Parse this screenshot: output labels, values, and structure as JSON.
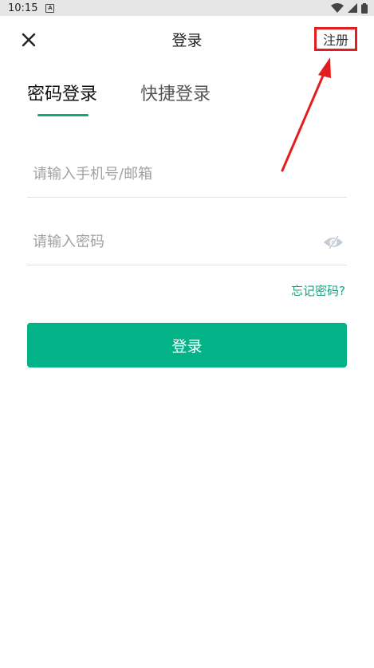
{
  "status_bar": {
    "time": "10:15",
    "notification_icon": "A",
    "icons": [
      "wifi-icon",
      "signal-icon",
      "battery-icon"
    ]
  },
  "header": {
    "title": "登录",
    "close_icon": "close-icon",
    "register_label": "注册"
  },
  "tabs": [
    {
      "label": "密码登录",
      "active": true
    },
    {
      "label": "快捷登录",
      "active": false
    }
  ],
  "form": {
    "account_placeholder": "请输入手机号/邮箱",
    "account_value": "",
    "password_placeholder": "请输入密码",
    "password_value": "",
    "password_visibility_icon": "eye-off-icon",
    "forgot_label": "忘记密码?",
    "login_label": "登录"
  },
  "colors": {
    "accent": "#03b287",
    "highlight_box": "#e31d1d",
    "annotation_arrow": "#e31d1d"
  }
}
